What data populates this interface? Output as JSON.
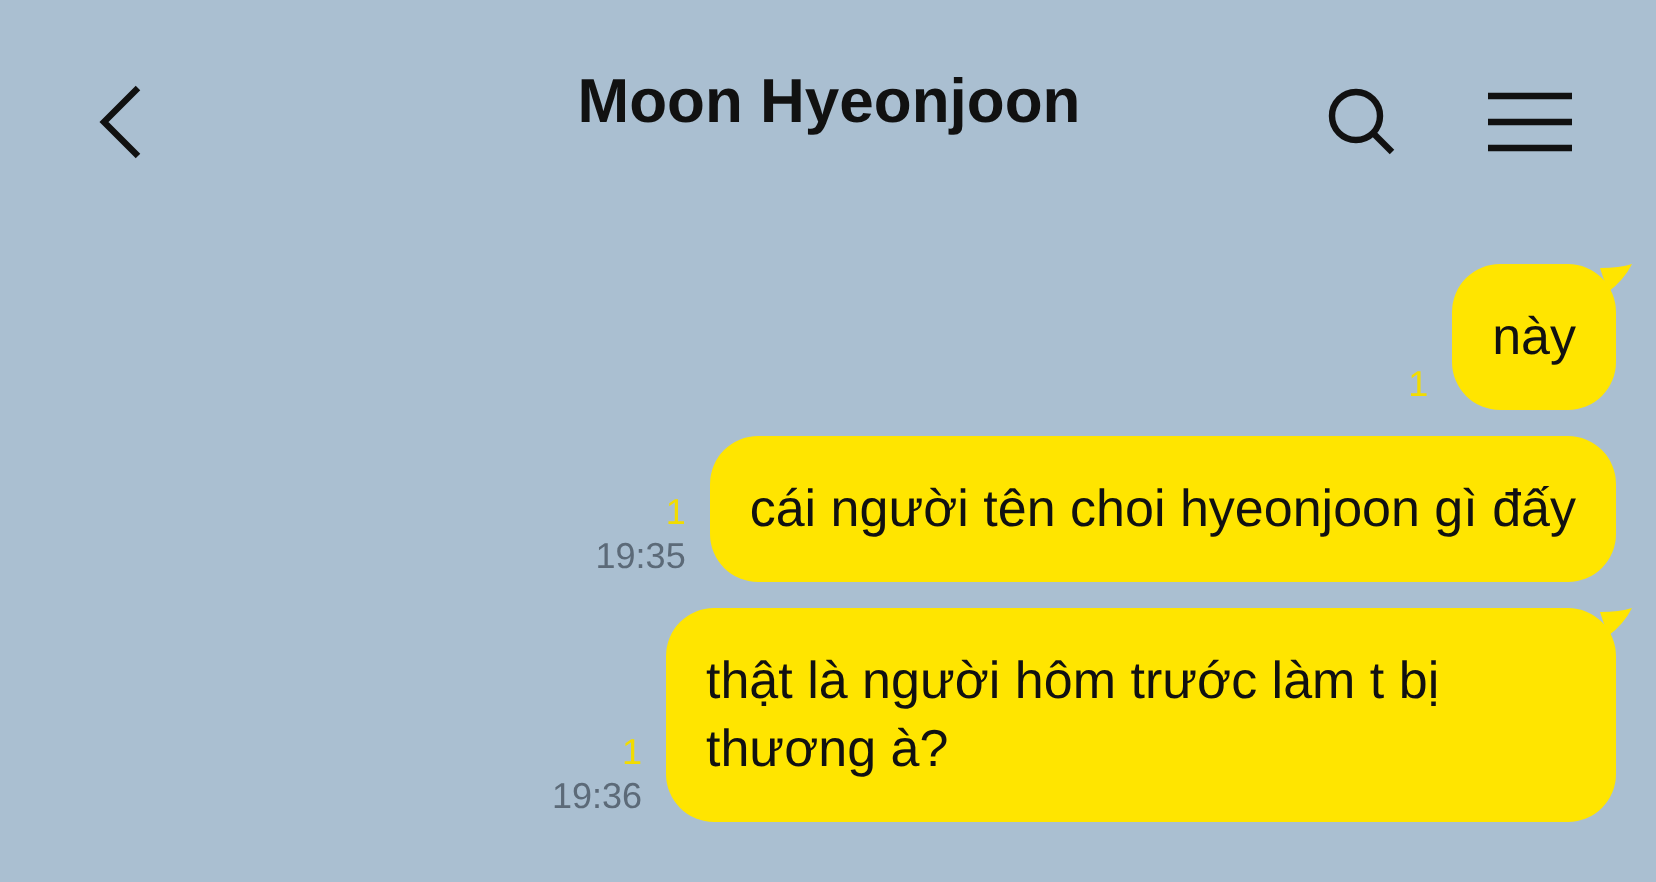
{
  "header": {
    "title": "Moon Hyeonjoon"
  },
  "messages": [
    {
      "text": "này",
      "unread": "1",
      "tail": true
    },
    {
      "text": "cái người tên choi hyeonjoon gì đấy",
      "unread": "1",
      "time": "19:35",
      "tail": false
    },
    {
      "text": "thật là người hôm trước làm t bị thương à?",
      "unread": "1",
      "time": "19:36",
      "tail": true
    }
  ]
}
